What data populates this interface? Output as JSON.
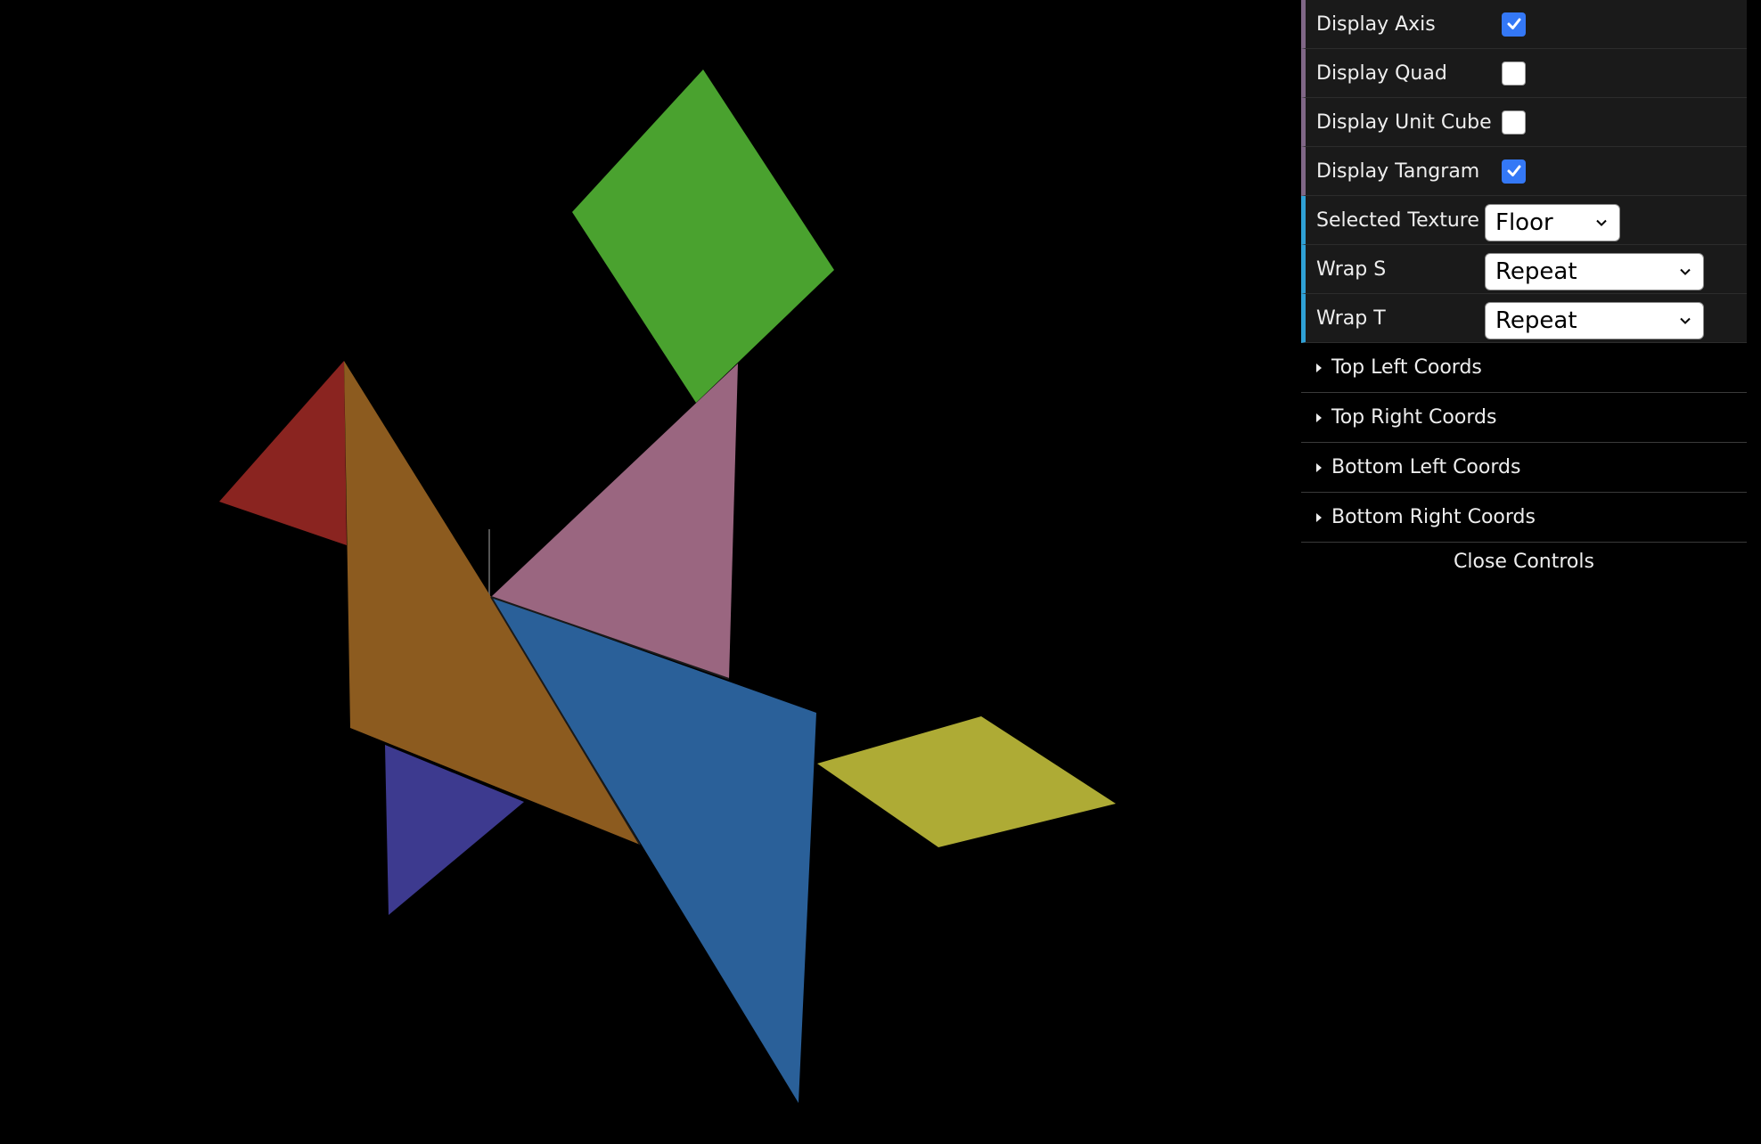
{
  "controls": {
    "display_axis": {
      "label": "Display Axis",
      "checked": true
    },
    "display_quad": {
      "label": "Display Quad",
      "checked": false
    },
    "display_unit_cube": {
      "label": "Display Unit Cube",
      "checked": false
    },
    "display_tangram": {
      "label": "Display Tangram",
      "checked": true
    },
    "selected_texture": {
      "label": "Selected Texture",
      "value": "Floor"
    },
    "wrap_s": {
      "label": "Wrap S",
      "value": "Repeat"
    },
    "wrap_t": {
      "label": "Wrap T",
      "value": "Repeat"
    }
  },
  "folders": [
    {
      "label": "Top Left Coords"
    },
    {
      "label": "Top Right Coords"
    },
    {
      "label": "Bottom Left Coords"
    },
    {
      "label": "Bottom Right Coords"
    }
  ],
  "close_label": "Close Controls",
  "scene": {
    "background": "#000000",
    "pieces": [
      {
        "name": "green-square",
        "color": "#4aa22f"
      },
      {
        "name": "red-small-triangle",
        "color": "#8a2420"
      },
      {
        "name": "pink-medium-triangle",
        "color": "#9a6680"
      },
      {
        "name": "orange-large-triangle",
        "color": "#8c5b1f"
      },
      {
        "name": "purple-small-triangle",
        "color": "#3d3a8f"
      },
      {
        "name": "blue-large-triangle",
        "color": "#2a6099"
      },
      {
        "name": "yellow-parallelogram",
        "color": "#aeab35"
      }
    ]
  },
  "colors": {
    "panel_bg": "#1a1a1a",
    "boolean_accent": "#806787",
    "option_accent": "#2fa1d6",
    "checkbox_on": "#3478f6"
  }
}
